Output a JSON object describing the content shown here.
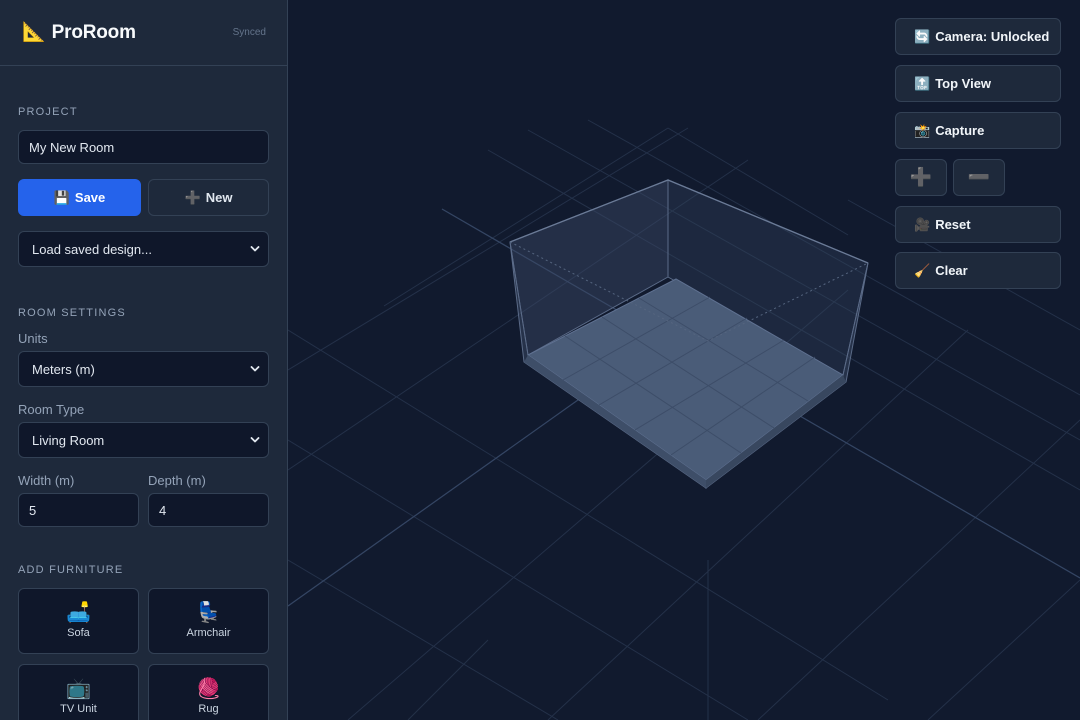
{
  "app": {
    "icon": "triangular-ruler-icon",
    "icon_glyph": "📐",
    "name": "ProRoom",
    "sync_status": "Synced"
  },
  "project": {
    "section_title": "PROJECT",
    "name_value": "My New Room",
    "save_icon": "💾",
    "save_label": "Save",
    "new_icon": "➕",
    "new_label": "New",
    "load_select": "Load saved design..."
  },
  "room_settings": {
    "section_title": "ROOM SETTINGS",
    "units_label": "Units",
    "units_value": "Meters (m)",
    "room_type_label": "Room Type",
    "room_type_value": "Living Room",
    "width_label": "Width (m)",
    "width_value": "5",
    "depth_label": "Depth (m)",
    "depth_value": "4"
  },
  "furniture": {
    "section_title": "ADD FURNITURE",
    "items": [
      {
        "label": "Sofa",
        "icon": "🛋️"
      },
      {
        "label": "Armchair",
        "icon": "💺"
      },
      {
        "label": "TV Unit",
        "icon": "📺"
      },
      {
        "label": "Rug",
        "icon": "🧶"
      }
    ]
  },
  "toolbar": {
    "camera_icon": "🔄",
    "camera_label": "Camera: Unlocked",
    "top_view_icon": "🔝",
    "top_view_label": "Top View",
    "capture_icon": "📸",
    "capture_label": "Capture",
    "zoom_in_glyph": "➕",
    "zoom_out_glyph": "➖",
    "reset_icon": "🎥",
    "reset_label": "Reset",
    "clear_icon": "🧹",
    "clear_label": "Clear"
  },
  "colors": {
    "sidebar_bg": "#1e293b",
    "viewport_bg": "#111a2e",
    "accent": "#2563eb",
    "border": "#334155",
    "floor": "#4a5c78"
  }
}
